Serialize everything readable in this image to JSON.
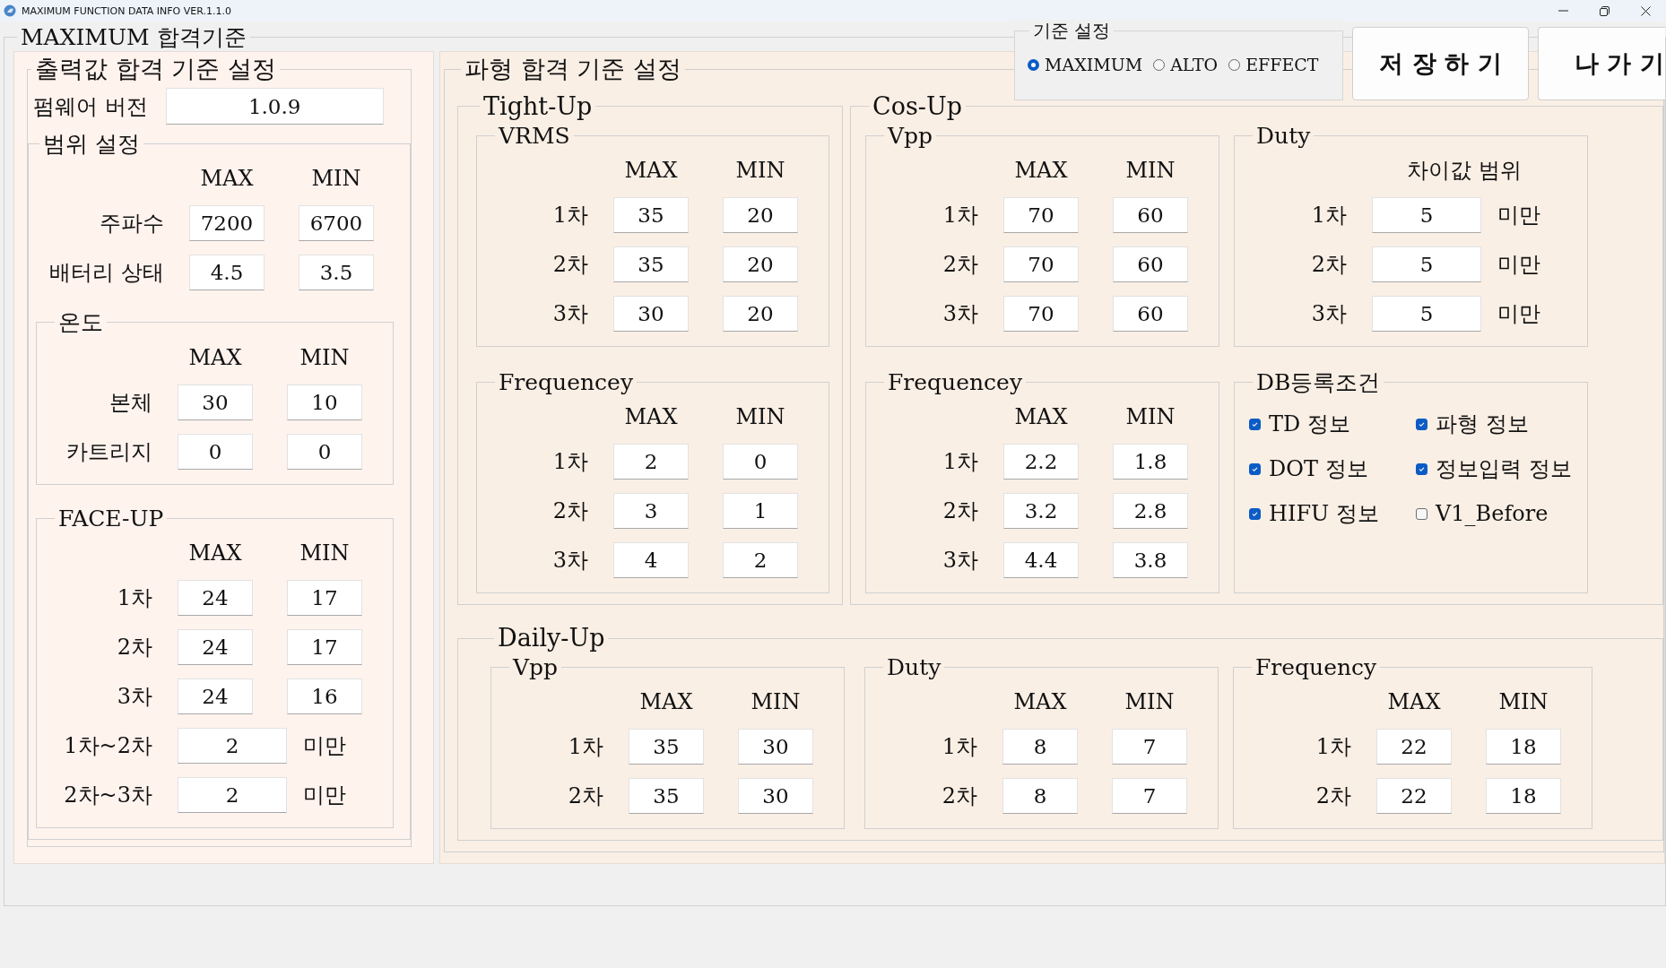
{
  "window": {
    "title": "MAXIMUM FUNCTION DATA INFO VER.1.1.0"
  },
  "frame": {
    "title": "MAXIMUM 합격기준"
  },
  "mode": {
    "title": "기준 설정",
    "options": [
      {
        "label": "MAXIMUM",
        "selected": true
      },
      {
        "label": "ALTO",
        "selected": false
      },
      {
        "label": "EFFECT",
        "selected": false
      }
    ]
  },
  "buttons": [
    {
      "label": "저 장 하 기"
    },
    {
      "label": "나 가 기"
    }
  ],
  "output_panel": {
    "title": "출력값 합격 기준 설정",
    "firmware": {
      "label": "펌웨어 버전",
      "value": "1.0.9"
    },
    "range": {
      "title": "범위 설정",
      "header": [
        "MAX",
        "MIN"
      ],
      "rows": [
        {
          "label": "주파수",
          "values": [
            "7200",
            "6700"
          ]
        },
        {
          "label": "배터리 상태",
          "values": [
            "4.5",
            "3.5"
          ]
        }
      ],
      "groups": [
        {
          "title": "온도",
          "kind": "table",
          "header": [
            "MAX",
            "MIN"
          ],
          "rows": [
            {
              "label": "본체",
              "values": [
                "30",
                "10"
              ]
            },
            {
              "label": "카트리지",
              "values": [
                "0",
                "0"
              ]
            }
          ]
        },
        {
          "title": "FACE-UP",
          "kind": "table",
          "header": [
            "MAX",
            "MIN"
          ],
          "rows": [
            {
              "label": "1차",
              "values": [
                "24",
                "17"
              ]
            },
            {
              "label": "2차",
              "values": [
                "24",
                "17"
              ]
            },
            {
              "label": "3차",
              "values": [
                "24",
                "16"
              ]
            },
            {
              "label": "1차~2차",
              "values": [
                "2"
              ],
              "suffix": "미만"
            },
            {
              "label": "2차~3차",
              "values": [
                "2"
              ],
              "suffix": "미만"
            }
          ]
        }
      ]
    }
  },
  "waveform_panel": {
    "title": "파형 합격 기준 설정",
    "sections": [
      {
        "title": "Tight-Up",
        "groups": [
          {
            "title": "VRMS",
            "kind": "table",
            "header": [
              "MAX",
              "MIN"
            ],
            "rows": [
              {
                "label": "1차",
                "values": [
                  "35",
                  "20"
                ]
              },
              {
                "label": "2차",
                "values": [
                  "35",
                  "20"
                ]
              },
              {
                "label": "3차",
                "values": [
                  "30",
                  "20"
                ]
              }
            ]
          },
          {
            "title": "Frequencey",
            "kind": "table",
            "header": [
              "MAX",
              "MIN"
            ],
            "rows": [
              {
                "label": "1차",
                "values": [
                  "2",
                  "0"
                ]
              },
              {
                "label": "2차",
                "values": [
                  "3",
                  "1"
                ]
              },
              {
                "label": "3차",
                "values": [
                  "4",
                  "2"
                ]
              }
            ]
          }
        ]
      },
      {
        "title": "Cos-Up",
        "groups": [
          {
            "title": "Vpp",
            "kind": "table",
            "header": [
              "MAX",
              "MIN"
            ],
            "rows": [
              {
                "label": "1차",
                "values": [
                  "70",
                  "60"
                ]
              },
              {
                "label": "2차",
                "values": [
                  "70",
                  "60"
                ]
              },
              {
                "label": "3차",
                "values": [
                  "70",
                  "60"
                ]
              }
            ]
          },
          {
            "title": "Duty",
            "kind": "table",
            "header": [
              "차이값 범위"
            ],
            "rows": [
              {
                "label": "1차",
                "values": [
                  "5"
                ],
                "suffix": "미만"
              },
              {
                "label": "2차",
                "values": [
                  "5"
                ],
                "suffix": "미만"
              },
              {
                "label": "3차",
                "values": [
                  "5"
                ],
                "suffix": "미만"
              }
            ]
          },
          {
            "title": "Frequencey",
            "kind": "table",
            "header": [
              "MAX",
              "MIN"
            ],
            "rows": [
              {
                "label": "1차",
                "values": [
                  "2.2",
                  "1.8"
                ]
              },
              {
                "label": "2차",
                "values": [
                  "3.2",
                  "2.8"
                ]
              },
              {
                "label": "3차",
                "values": [
                  "4.4",
                  "3.8"
                ]
              }
            ]
          },
          {
            "title": "DB등록조건",
            "kind": "checklist",
            "items": [
              {
                "label": "TD 정보",
                "checked": true
              },
              {
                "label": "파형 정보",
                "checked": true
              },
              {
                "label": "DOT 정보",
                "checked": true
              },
              {
                "label": "정보입력 정보",
                "checked": true
              },
              {
                "label": "HIFU 정보",
                "checked": true
              },
              {
                "label": "V1_Before",
                "checked": false
              }
            ]
          }
        ]
      },
      {
        "title": "Daily-Up",
        "groups": [
          {
            "title": "Vpp",
            "kind": "table",
            "header": [
              "MAX",
              "MIN"
            ],
            "rows": [
              {
                "label": "1차",
                "values": [
                  "35",
                  "30"
                ]
              },
              {
                "label": "2차",
                "values": [
                  "35",
                  "30"
                ]
              }
            ]
          },
          {
            "title": "Duty",
            "kind": "table",
            "header": [
              "MAX",
              "MIN"
            ],
            "rows": [
              {
                "label": "1차",
                "values": [
                  "8",
                  "7"
                ]
              },
              {
                "label": "2차",
                "values": [
                  "8",
                  "7"
                ]
              }
            ]
          },
          {
            "title": "Frequency",
            "kind": "table",
            "header": [
              "MAX",
              "MIN"
            ],
            "rows": [
              {
                "label": "1차",
                "values": [
                  "22",
                  "18"
                ]
              },
              {
                "label": "2차",
                "values": [
                  "22",
                  "18"
                ]
              }
            ]
          }
        ]
      }
    ]
  }
}
